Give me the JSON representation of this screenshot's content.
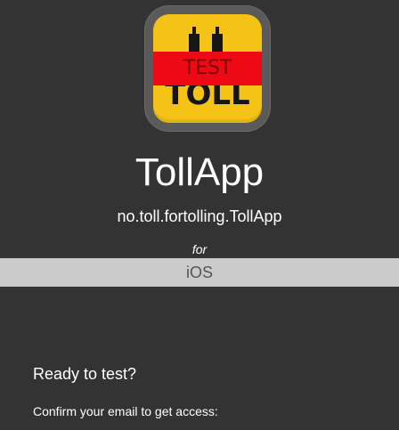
{
  "app": {
    "icon_banner": "TEST",
    "icon_word": "TOLL",
    "name": "TollApp",
    "bundle_id": "no.toll.fortolling.TollApp"
  },
  "platform": {
    "for_label": "for",
    "name": "iOS"
  },
  "access": {
    "heading": "Ready to test?",
    "instruction": "Confirm your email to get access:"
  },
  "colors": {
    "background": "#333333",
    "icon_yellow": "#f5c316",
    "test_banner_red": "#ee0a14",
    "platform_bar": "#cbcbcb"
  },
  "icons": {
    "app_icon": "toll-app-icon"
  }
}
